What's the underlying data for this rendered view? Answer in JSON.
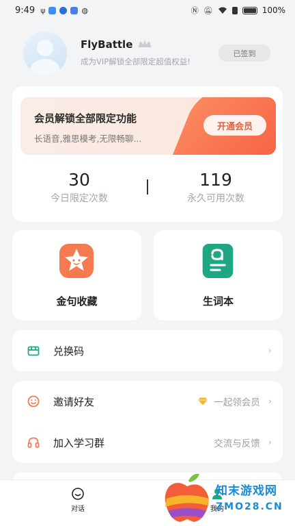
{
  "status_bar": {
    "time": "9:49",
    "battery_text": "100%",
    "icons": [
      "usb-icon",
      "shield-icon",
      "app-icon",
      "app-icon",
      "wechat-icon",
      "nfc-icon",
      "mute-icon",
      "wifi-icon",
      "sim-icon",
      "battery-icon"
    ]
  },
  "profile": {
    "username": "FlyBattle",
    "vip_subtitle": "成为VIP解锁全部限定超值权益!",
    "checkin_label": "已签到"
  },
  "vip_card": {
    "title": "会员解锁全部限定功能",
    "description": "长语音,雅思模考,无限畅聊...",
    "open_button": "开通会员",
    "stats": [
      {
        "value": "30",
        "label": "今日限定次数"
      },
      {
        "value": "119",
        "label": "永久可用次数"
      }
    ]
  },
  "tiles": [
    {
      "label": "金句收藏",
      "icon": "star-face-icon",
      "color": "#f47a52"
    },
    {
      "label": "生词本",
      "icon": "vocabulary-book-icon",
      "color": "#1fa784"
    }
  ],
  "menu_group_1": [
    {
      "label": "兑换码",
      "icon": "gift-card-icon",
      "right_text": ""
    }
  ],
  "menu_group_2": [
    {
      "label": "邀请好友",
      "icon": "smile-icon",
      "right_text": "一起领会员",
      "right_icon": "diamond-icon"
    },
    {
      "label": "加入学习群",
      "icon": "headset-icon",
      "right_text": "交流与反馈"
    }
  ],
  "tab_bar": [
    {
      "label": "对话",
      "icon": "chat-bubble-icon"
    },
    {
      "label": "我的",
      "icon": "profile-icon"
    }
  ],
  "watermark": {
    "name": "知末游戏网",
    "url": "ZMO28.CN"
  },
  "colors": {
    "accent_orange": "#f65e43",
    "accent_green": "#1fa784",
    "background": "#f3f4f6"
  }
}
